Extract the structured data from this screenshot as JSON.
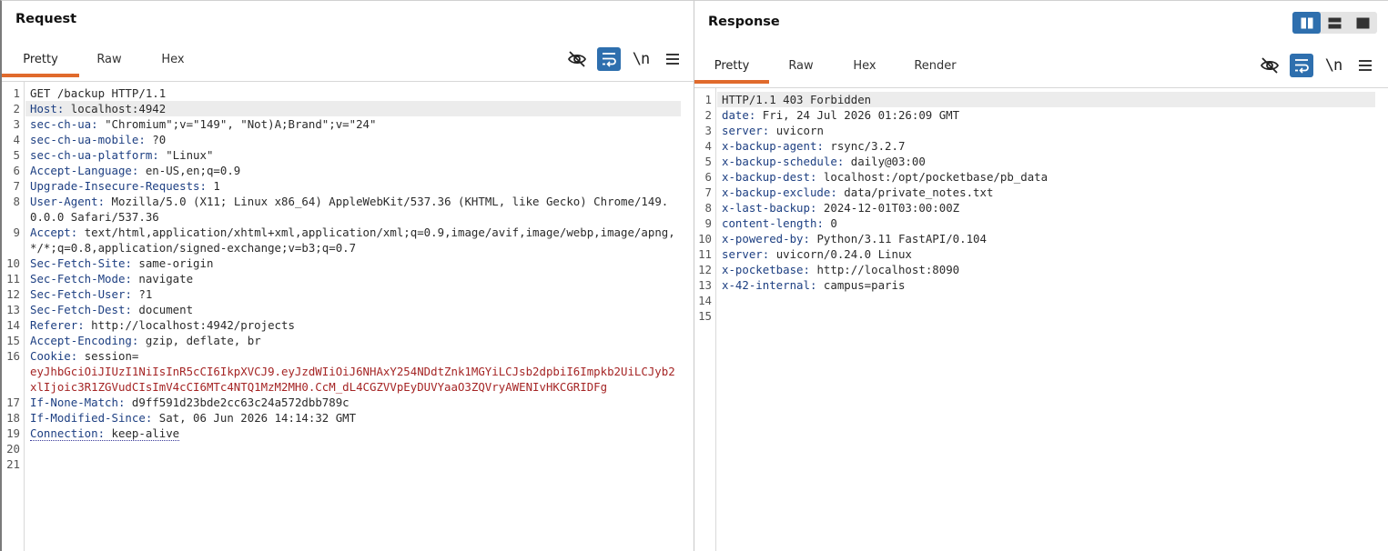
{
  "layout_switch": [
    "side-by-side-icon",
    "stacked-icon",
    "single-pane-icon"
  ],
  "request": {
    "title": "Request",
    "tabs": [
      {
        "label": "Pretty",
        "active": true
      },
      {
        "label": "Raw",
        "active": false
      },
      {
        "label": "Hex",
        "active": false
      }
    ],
    "tools": [
      "hide-nonprintable-icon",
      "wrap-lines-icon",
      "show-newlines-icon",
      "menu-icon"
    ],
    "newline_label": "\\n",
    "lines": [
      {
        "n": "1",
        "plain": "GET /backup HTTP/1.1"
      },
      {
        "n": "2",
        "name": "Host",
        "value": " localhost:4942",
        "highlight": true
      },
      {
        "n": "3",
        "name": "sec-ch-ua",
        "value": " \"Chromium\";v=\"149\", \"Not)A;Brand\";v=\"24\""
      },
      {
        "n": "4",
        "name": "sec-ch-ua-mobile",
        "value": " ?0"
      },
      {
        "n": "5",
        "name": "sec-ch-ua-platform",
        "value": " \"Linux\""
      },
      {
        "n": "6",
        "name": "Accept-Language",
        "value": " en-US,en;q=0.9"
      },
      {
        "n": "7",
        "name": "Upgrade-Insecure-Requests",
        "value": " 1"
      },
      {
        "n": "8",
        "name": "User-Agent",
        "value": " Mozilla/5.0 (X11; Linux x86_64) AppleWebKit/537.36 (KHTML, like Gecko) Chrome/149.0.0.0 Safari/537.36"
      },
      {
        "n": "9",
        "name": "Accept",
        "value": " text/html,application/xhtml+xml,application/xml;q=0.9,image/avif,image/webp,image/apng,*/*;q=0.8,application/signed-exchange;v=b3;q=0.7"
      },
      {
        "n": "10",
        "name": "Sec-Fetch-Site",
        "value": " same-origin"
      },
      {
        "n": "11",
        "name": "Sec-Fetch-Mode",
        "value": " navigate"
      },
      {
        "n": "12",
        "name": "Sec-Fetch-User",
        "value": " ?1"
      },
      {
        "n": "13",
        "name": "Sec-Fetch-Dest",
        "value": " document"
      },
      {
        "n": "14",
        "name": "Referer",
        "value": " http://localhost:4942/projects"
      },
      {
        "n": "15",
        "name": "Accept-Encoding",
        "value": " gzip, deflate, br"
      },
      {
        "n": "16",
        "name": "Cookie",
        "value": " session=",
        "cookie": "eyJhbGciOiJIUzI1NiIsInR5cCI6IkpXVCJ9.eyJzdWIiOiJ6NHAxY254NDdtZnk1MGYiLCJsb2dpbiI6Impkb2UiLCJyb2xlIjoic3R1ZGVudCIsImV4cCI6MTc4NTQ1MzM2MH0.CcM_dL4CGZVVpEyDUVYaaO3ZQVryAWENIvHKCGRIDFg"
      },
      {
        "n": "17",
        "name": "If-None-Match",
        "value": " d9ff591d23bde2cc63c24a572dbb789c"
      },
      {
        "n": "18",
        "name": "If-Modified-Since",
        "value": " Sat, 06 Jun 2026 14:14:32 GMT"
      },
      {
        "n": "19",
        "name": "Connection",
        "value": " keep-alive",
        "dotted": true
      },
      {
        "n": "20"
      },
      {
        "n": "21"
      }
    ]
  },
  "response": {
    "title": "Response",
    "tabs": [
      {
        "label": "Pretty",
        "active": true
      },
      {
        "label": "Raw",
        "active": false
      },
      {
        "label": "Hex",
        "active": false
      },
      {
        "label": "Render",
        "active": false
      }
    ],
    "tools": [
      "hide-nonprintable-icon",
      "wrap-lines-icon",
      "show-newlines-icon",
      "menu-icon"
    ],
    "newline_label": "\\n",
    "lines": [
      {
        "n": "1",
        "plain": "HTTP/1.1 403 Forbidden",
        "highlight": true
      },
      {
        "n": "2",
        "name": "date",
        "value": " Fri, 24 Jul 2026 01:26:09 GMT"
      },
      {
        "n": "3",
        "name": "server",
        "value": " uvicorn"
      },
      {
        "n": "4",
        "name": "x-backup-agent",
        "value": " rsync/3.2.7"
      },
      {
        "n": "5",
        "name": "x-backup-schedule",
        "value": " daily@03:00"
      },
      {
        "n": "6",
        "name": "x-backup-dest",
        "value": " localhost:/opt/pocketbase/pb_data"
      },
      {
        "n": "7",
        "name": "x-backup-exclude",
        "value": " data/private_notes.txt"
      },
      {
        "n": "8",
        "name": "x-last-backup",
        "value": " 2024-12-01T03:00:00Z"
      },
      {
        "n": "9",
        "name": "content-length",
        "value": " 0"
      },
      {
        "n": "10",
        "name": "x-powered-by",
        "value": " Python/3.11 FastAPI/0.104"
      },
      {
        "n": "11",
        "name": "server",
        "value": " uvicorn/0.24.0 Linux"
      },
      {
        "n": "12",
        "name": "x-pocketbase",
        "value": " http://localhost:8090"
      },
      {
        "n": "13",
        "name": "x-42-internal",
        "value": " campus=paris"
      },
      {
        "n": "14"
      },
      {
        "n": "15"
      }
    ]
  }
}
